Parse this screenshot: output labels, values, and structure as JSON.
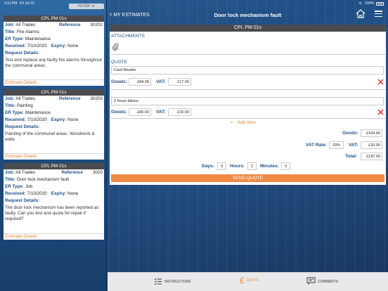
{
  "status": {
    "time": "3:11 PM",
    "date": "Fri Jul 10",
    "battery": "100%"
  },
  "left": {
    "filter_label": "FILTER",
    "cards": [
      {
        "header": "CPL PM 01s",
        "job_label": "Job:",
        "job": "All Trades",
        "ref_label": "Reference",
        "ref": "30202",
        "title_label": "Title:",
        "title": "Fire Alarms",
        "er_label": "ER Type:",
        "er": "Maintenance",
        "received_label": "Received:",
        "received": "7/10/2020",
        "expiry_label": "Expiry:",
        "expiry": "None",
        "request_label": "Request Details:",
        "request": "Test and replace any faulty fire alarms throughout the communal areas",
        "footer": "Estimate Details"
      },
      {
        "header": "CPL PM 01s",
        "job_label": "Job:",
        "job": "All Trades",
        "ref_label": "Reference",
        "ref": "30203",
        "title_label": "Title:",
        "title": "Painting",
        "er_label": "ER Type:",
        "er": "Maintenance",
        "received_label": "Received:",
        "received": "7/10/2020",
        "expiry_label": "Expiry:",
        "expiry": "None",
        "request_label": "Request Details:",
        "request": "Painting of the communal areas. Woodwork & walls",
        "footer": "Estimate Details"
      },
      {
        "header": "CPL PM 01s",
        "job_label": "Job:",
        "job": "All Trades",
        "ref_label": "Reference",
        "ref": "3020",
        "title_label": "Title:",
        "title": "Door lock mechanism fault",
        "er_label": "ER Type:",
        "er": "Job",
        "received_label": "Received:",
        "received": "7/10/2020",
        "expiry_label": "Expiry:",
        "expiry": "None",
        "request_label": "Request Details:",
        "request": "The door lock mechanism has been reported as faulty. Can you test and quote for repair if required?",
        "footer": "Estimate Details"
      }
    ]
  },
  "topbar": {
    "back_label": "MY ESTIMATES",
    "title": "Door lock mechanism fault"
  },
  "panel": {
    "header": "CPL PM 01s",
    "attachments_label": "ATTACHMENTS",
    "quote_label": "QUOTE",
    "items": [
      {
        "description": "Card Reader",
        "goods_label": "Goods:",
        "goods": "£84.99",
        "vat_label": "VAT:",
        "vat": "£17.00"
      },
      {
        "description": "2 hours labour",
        "goods_label": "Goods:",
        "goods": "£80.00",
        "vat_label": "VAT:",
        "vat": "£16.00"
      }
    ],
    "add_item_label": "Add Item",
    "totals": {
      "goods_label": "Goods:",
      "goods": "£164.99",
      "vat_rate_label": "VAT Rate:",
      "vat_rate": "20%",
      "vat_label": "VAT:",
      "vat": "£33.00",
      "total_label": "Total:",
      "total": "£197.99"
    },
    "time": {
      "days_label": "Days:",
      "days": "0",
      "hours_label": "Hours:",
      "hours": "2",
      "minutes_label": "Minutes:",
      "minutes": "0"
    },
    "send_label": "SEND QUOTE"
  },
  "bottom_tabs": [
    {
      "label": "INSTRUCTIONS",
      "icon": "list-icon"
    },
    {
      "label": "QUOTE",
      "icon": "pound-icon",
      "active": true
    },
    {
      "label": "COMMENTS",
      "icon": "chat-icon"
    }
  ],
  "colors": {
    "accent": "#e8833a",
    "label_blue": "#1f4f86",
    "header_grey": "#4b4b4f",
    "delete_red": "#d9262a"
  }
}
